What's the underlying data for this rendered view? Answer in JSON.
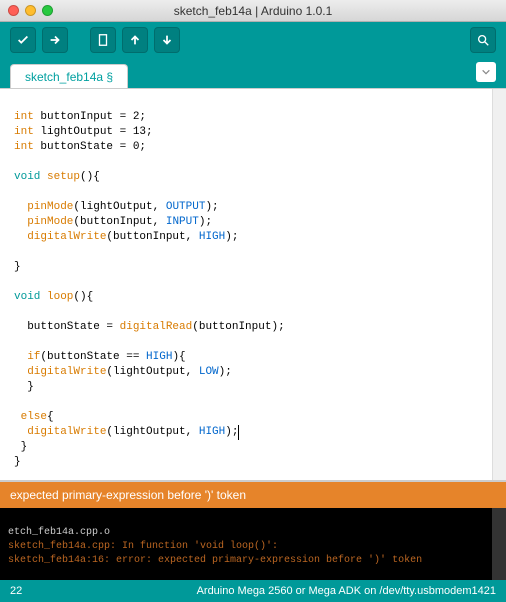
{
  "window": {
    "title": "sketch_feb14a | Arduino 1.0.1"
  },
  "tab": {
    "label": "sketch_feb14a §"
  },
  "code": {
    "l1a": "int",
    "l1b": " buttonInput = 2;",
    "l2a": "int",
    "l2b": " lightOutput = 13;",
    "l3a": "int",
    "l3b": " buttonState = 0;",
    "l5a": "void",
    "l5b": " setup",
    "l5c": "(){",
    "l7a": "  pinMode",
    "l7b": "(lightOutput, ",
    "l7c": "OUTPUT",
    "l7d": ");",
    "l8a": "  pinMode",
    "l8b": "(buttonInput, ",
    "l8c": "INPUT",
    "l8d": ");",
    "l9a": "  digitalWrite",
    "l9b": "(buttonInput, ",
    "l9c": "HIGH",
    "l9d": ");",
    "l11": "}",
    "l13a": "void",
    "l13b": " loop",
    "l13c": "(){",
    "l15a": "  buttonState = ",
    "l15b": "digitalRead",
    "l15c": "(buttonInput);",
    "l17a": "  if",
    "l17b": "(buttonState == ",
    "l17c": "HIGH",
    "l17d": "){",
    "l18a": "  digitalWrite",
    "l18b": "(lightOutput, ",
    "l18c": "LOW",
    "l18d": ");",
    "l19": "  }",
    "l21a": " else",
    "l21b": "{",
    "l22a": "  digitalWrite",
    "l22b": "(lightOutput, ",
    "l22c": "HIGH",
    "l22d": ");",
    "l23": " }",
    "l24": "}"
  },
  "error": {
    "message": "expected primary-expression before ')' token"
  },
  "console": {
    "l1": "etch_feb14a.cpp.o",
    "l2": "sketch_feb14a.cpp: In function 'void loop()':",
    "l3": "sketch_feb14a:16: error: expected primary-expression before ')' token"
  },
  "status": {
    "line": "22",
    "board": "Arduino Mega 2560 or Mega ADK on /dev/tty.usbmodem1421"
  }
}
